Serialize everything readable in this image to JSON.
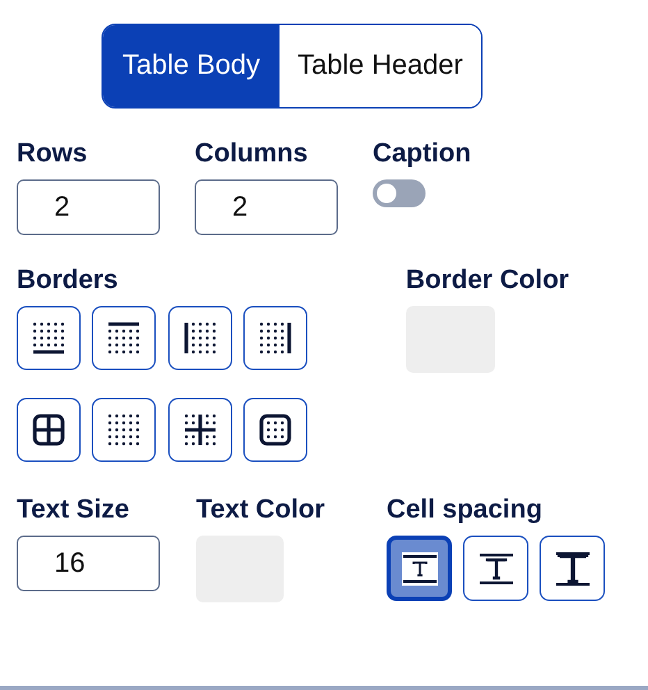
{
  "tabs": [
    {
      "label": "Table Body",
      "selected": true
    },
    {
      "label": "Table Header",
      "selected": false
    }
  ],
  "rows": {
    "label": "Rows",
    "value": "2"
  },
  "columns": {
    "label": "Columns",
    "value": "2"
  },
  "caption": {
    "label": "Caption",
    "on": false
  },
  "borders": {
    "label": "Borders",
    "options": [
      {
        "kind": "bottom",
        "selected": false
      },
      {
        "kind": "top",
        "selected": false
      },
      {
        "kind": "left",
        "selected": false
      },
      {
        "kind": "right",
        "selected": false
      },
      {
        "kind": "all",
        "selected": false
      },
      {
        "kind": "none",
        "selected": false
      },
      {
        "kind": "inner",
        "selected": false
      },
      {
        "kind": "outer",
        "selected": false
      }
    ]
  },
  "border_color": {
    "label": "Border Color",
    "color": "#eeeeee"
  },
  "text_size": {
    "label": "Text Size",
    "value": "16"
  },
  "text_color": {
    "label": "Text Color",
    "color": "#eeeeee"
  },
  "cell_spacing": {
    "label": "Cell spacing",
    "options": [
      {
        "kind": "small",
        "selected": true
      },
      {
        "kind": "medium",
        "selected": false
      },
      {
        "kind": "large",
        "selected": false
      }
    ]
  }
}
